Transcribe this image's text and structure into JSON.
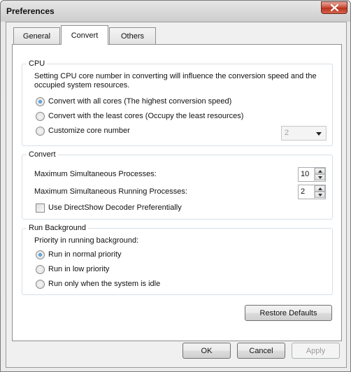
{
  "window": {
    "title": "Preferences"
  },
  "tabs": [
    {
      "label": "General",
      "active": false
    },
    {
      "label": "Convert",
      "active": true
    },
    {
      "label": "Others",
      "active": false
    }
  ],
  "cpu": {
    "legend": "CPU",
    "description_line1": "Setting CPU core number in converting will influence the conversion speed and the",
    "description_line2": "occupied system resources.",
    "options": [
      {
        "label": "Convert with all cores (The highest conversion speed)",
        "checked": true
      },
      {
        "label": "Convert with the least cores (Occupy the least resources)",
        "checked": false
      },
      {
        "label": "Customize core number",
        "checked": false
      }
    ],
    "core_select": {
      "value": "2",
      "enabled": false
    }
  },
  "convert": {
    "legend": "Convert",
    "max_processes_label": "Maximum Simultaneous Processes:",
    "max_processes_value": "10",
    "max_running_label": "Maximum Simultaneous Running Processes:",
    "max_running_value": "2",
    "directshow_label": "Use DirectShow Decoder Preferentially",
    "directshow_checked": false
  },
  "background": {
    "legend": "Run Background",
    "priority_label": "Priority in running background:",
    "options": [
      {
        "label": "Run in normal priority",
        "checked": true
      },
      {
        "label": "Run in low priority",
        "checked": false
      },
      {
        "label": "Run only when the system is idle",
        "checked": false
      }
    ]
  },
  "buttons": {
    "restore_defaults": "Restore Defaults",
    "ok": "OK",
    "cancel": "Cancel",
    "apply": "Apply",
    "apply_enabled": false
  },
  "icons": {
    "close": "close-icon",
    "dropdown": "chevron-down-icon",
    "spin_up": "spin-up-icon",
    "spin_down": "spin-down-icon"
  }
}
